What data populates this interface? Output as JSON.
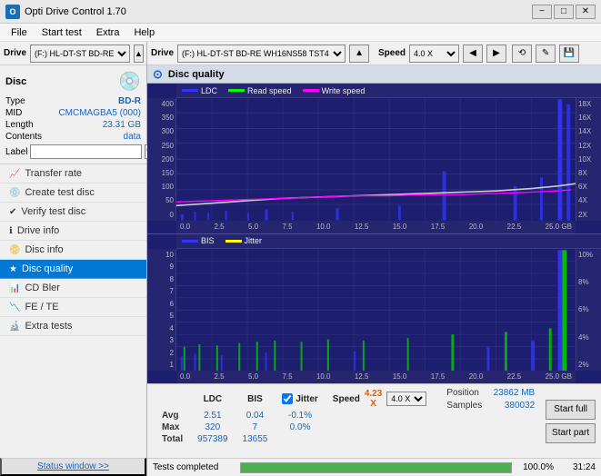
{
  "app": {
    "title": "Opti Drive Control 1.70",
    "icon": "O"
  },
  "titlebar": {
    "title": "Opti Drive Control 1.70",
    "minimize_label": "−",
    "maximize_label": "□",
    "close_label": "✕"
  },
  "menubar": {
    "items": [
      {
        "label": "File",
        "id": "file"
      },
      {
        "label": "Start test",
        "id": "start-test"
      },
      {
        "label": "Extra",
        "id": "extra"
      },
      {
        "label": "Help",
        "id": "help"
      }
    ]
  },
  "drive_bar": {
    "label": "Drive",
    "drive_value": "(F:)  HL-DT-ST BD-RE  WH16NS58 TST4",
    "eject_label": "▲"
  },
  "speed_bar": {
    "label": "Speed",
    "speed_value": "4.0 X",
    "btn1": "◀",
    "btn2": "▶",
    "btn3": "⟲",
    "btn4": "✎",
    "btn5": "💾"
  },
  "disc": {
    "header": "Disc",
    "type_label": "Type",
    "type_value": "BD-R",
    "mid_label": "MID",
    "mid_value": "CMCMAGBA5 (000)",
    "length_label": "Length",
    "length_value": "23.31 GB",
    "contents_label": "Contents",
    "contents_value": "data",
    "label_label": "Label",
    "label_placeholder": "",
    "label_btn": "🔍"
  },
  "nav": {
    "items": [
      {
        "id": "transfer-rate",
        "label": "Transfer rate",
        "icon": "📈"
      },
      {
        "id": "create-test-disc",
        "label": "Create test disc",
        "icon": "💿"
      },
      {
        "id": "verify-test-disc",
        "label": "Verify test disc",
        "icon": "✔"
      },
      {
        "id": "drive-info",
        "label": "Drive info",
        "icon": "ℹ"
      },
      {
        "id": "disc-info",
        "label": "Disc info",
        "icon": "📀"
      },
      {
        "id": "disc-quality",
        "label": "Disc quality",
        "icon": "★",
        "active": true
      },
      {
        "id": "cd-bler",
        "label": "CD Bler",
        "icon": "📊"
      },
      {
        "id": "fe-te",
        "label": "FE / TE",
        "icon": "📉"
      },
      {
        "id": "extra-tests",
        "label": "Extra tests",
        "icon": "🔬"
      }
    ]
  },
  "status_window": {
    "label": "Status window >>"
  },
  "statusbar": {
    "text": "Tests completed",
    "progress": 100,
    "percent": "100.0%",
    "time": "31:24"
  },
  "disc_quality": {
    "title": "Disc quality"
  },
  "chart_upper": {
    "legend": [
      {
        "label": "LDC",
        "color": "#0000ff"
      },
      {
        "label": "Read speed",
        "color": "#00ff00"
      },
      {
        "label": "Write speed",
        "color": "#ff00ff"
      }
    ],
    "y_labels_left": [
      "400",
      "350",
      "300",
      "250",
      "200",
      "150",
      "100",
      "50",
      "0"
    ],
    "y_labels_right": [
      "18X",
      "16X",
      "14X",
      "12X",
      "10X",
      "8X",
      "6X",
      "4X",
      "2X"
    ],
    "x_labels": [
      "0.0",
      "2.5",
      "5.0",
      "7.5",
      "10.0",
      "12.5",
      "15.0",
      "17.5",
      "20.0",
      "22.5",
      "25.0 GB"
    ]
  },
  "chart_lower": {
    "legend": [
      {
        "label": "BIS",
        "color": "#0000ff"
      },
      {
        "label": "Jitter",
        "color": "#ffff00"
      }
    ],
    "y_labels_left": [
      "10",
      "9",
      "8",
      "7",
      "6",
      "5",
      "4",
      "3",
      "2",
      "1"
    ],
    "y_labels_right": [
      "10%",
      "8%",
      "6%",
      "4%",
      "2%"
    ],
    "x_labels": [
      "0.0",
      "2.5",
      "5.0",
      "7.5",
      "10.0",
      "12.5",
      "15.0",
      "17.5",
      "20.0",
      "22.5",
      "25.0 GB"
    ]
  },
  "stats": {
    "headers": [
      "LDC",
      "BIS",
      "",
      "Jitter",
      "Speed"
    ],
    "avg_label": "Avg",
    "avg_ldc": "2.51",
    "avg_bis": "0.04",
    "avg_jitter": "-0.1%",
    "avg_speed": "4.23 X",
    "max_label": "Max",
    "max_ldc": "320",
    "max_bis": "7",
    "max_jitter": "0.0%",
    "total_label": "Total",
    "total_ldc": "957389",
    "total_bis": "13655",
    "jitter_label": "Jitter",
    "speed_label": "Speed",
    "speed_value": "4.23 X",
    "speed_select": "4.0 X",
    "position_label": "Position",
    "position_value": "23862 MB",
    "samples_label": "Samples",
    "samples_value": "380032"
  },
  "buttons": {
    "start_full": "Start full",
    "start_part": "Start part"
  }
}
